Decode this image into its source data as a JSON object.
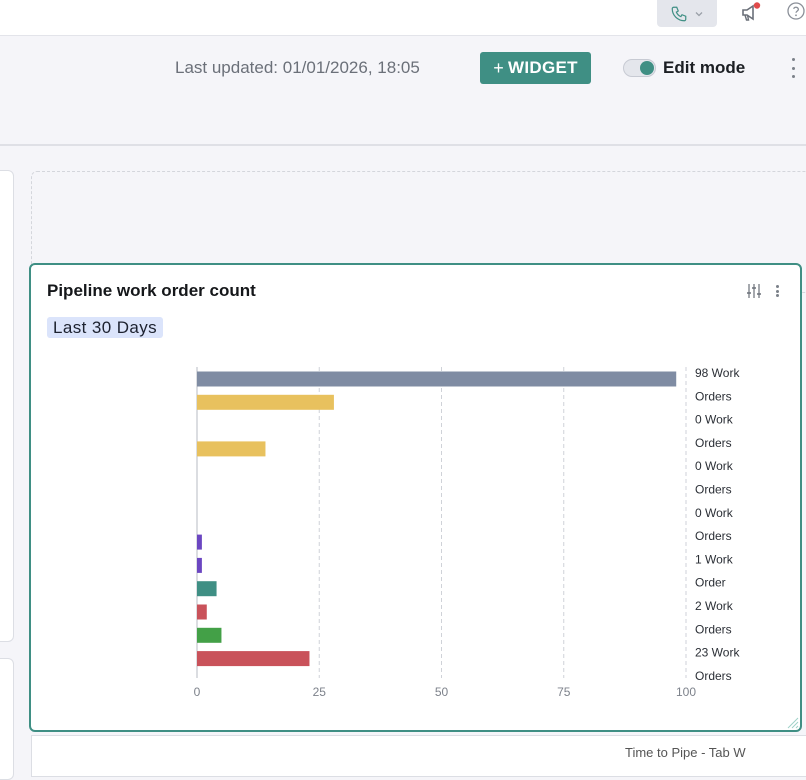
{
  "header": {
    "last_updated": "Last updated: 01/01/2026, 18:05",
    "widget_button": "WIDGET",
    "widget_plus": "+",
    "edit_mode_label": "Edit mode",
    "edit_mode_on": true
  },
  "colors": {
    "accent": "#3f8f84",
    "chip_bg": "#dbe4fb"
  },
  "icons": {
    "phone": "phone-icon",
    "chevron": "chevron-down-icon",
    "announcement": "megaphone-icon",
    "help": "help-icon",
    "filter": "sliders-icon",
    "more": "kebab-icon"
  },
  "footer_partial_text": "Time to Pipe - Tab W",
  "widget": {
    "title": "Pipeline work order count",
    "date_range": "Last 30 Days",
    "chart_data": {
      "type": "bar",
      "orientation": "horizontal",
      "xlim": [
        0,
        100
      ],
      "ticks": [
        "0",
        "25",
        "50",
        "75",
        "100"
      ],
      "grid": true,
      "bars": [
        {
          "value": 98,
          "color": "#7f8ca3"
        },
        {
          "value": 28,
          "color": "#e8c15e"
        },
        {
          "value": 0,
          "color": "#e8c15e"
        },
        {
          "value": 14,
          "color": "#e8c15e"
        },
        {
          "value": 0,
          "color": "#e8c15e"
        },
        {
          "value": 0,
          "color": "#e8c15e"
        },
        {
          "value": 0,
          "color": "#6b46c1"
        },
        {
          "value": 1,
          "color": "#6b46c1"
        },
        {
          "value": 1,
          "color": "#6b46c1"
        },
        {
          "value": 4,
          "color": "#3f8f84"
        },
        {
          "value": 2,
          "color": "#c9525a"
        },
        {
          "value": 5,
          "color": "#43a047"
        },
        {
          "value": 23,
          "color": "#c9525a"
        }
      ],
      "labels": [
        "98 Work",
        "Orders",
        "0 Work",
        "Orders",
        "0 Work",
        "Orders",
        "0 Work",
        "Orders",
        "1 Work",
        "Order",
        "2 Work",
        "Orders",
        "23 Work",
        "Orders"
      ]
    }
  }
}
